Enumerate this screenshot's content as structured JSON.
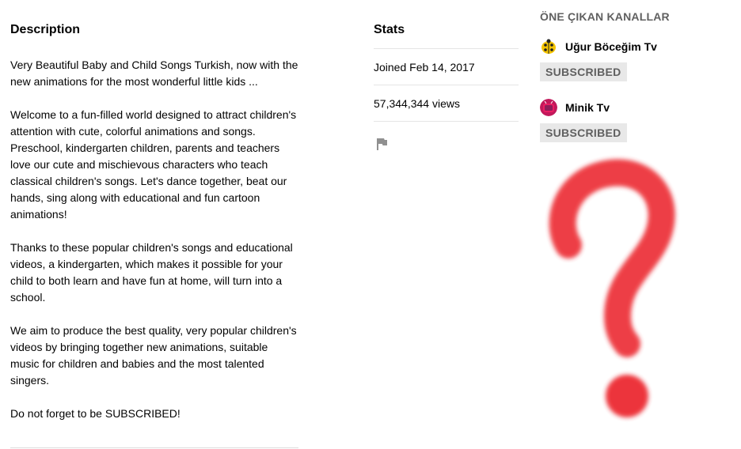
{
  "description": {
    "title": "Description",
    "paragraphs": [
      "Very Beautiful Baby and Child Songs Turkish, now with the new animations for the most wonderful little kids ...",
      "Welcome to a fun-filled world designed to attract children's attention with cute, colorful animations and songs. Preschool, kindergarten children, parents and teachers love our cute and mischievous characters who teach classical children's songs. Let's dance together, beat our hands, sing along with educational and fun cartoon animations!",
      "Thanks to these popular children's songs and educational videos, a kindergarten, which makes it possible for your child to both learn and have fun at home, will turn into a school.",
      "We aim to produce the best quality, very popular children's videos by bringing together new animations, suitable music for children and babies and the most talented singers.",
      "Do not forget to be SUBSCRIBED!"
    ]
  },
  "stats": {
    "title": "Stats",
    "joined": "Joined Feb 14, 2017",
    "views": "57,344,344 views",
    "flag_icon": "flag-icon"
  },
  "featured": {
    "title": "ÖNE ÇIKAN KANALLAR",
    "channels": [
      {
        "name": "Uğur Böceğim Tv",
        "button": "SUBSCRIBED",
        "icon": "ladybug-avatar-icon"
      },
      {
        "name": "Minik Tv",
        "button": "SUBSCRIBED",
        "icon": "minik-tv-avatar-icon"
      }
    ]
  },
  "overlay": {
    "icon": "question-mark-icon",
    "color": "#e8202a"
  }
}
